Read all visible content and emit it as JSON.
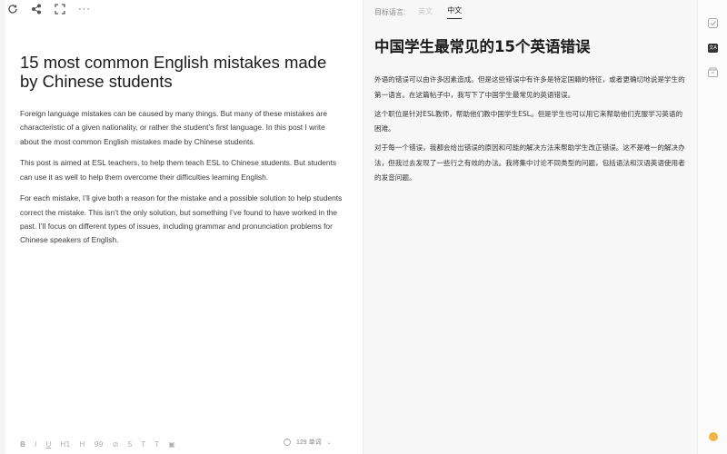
{
  "toolbar": {
    "icons": [
      "refresh-icon",
      "share-icon",
      "fullscreen-icon"
    ],
    "more_label": "···"
  },
  "document": {
    "title": "15 most common English mistakes made by Chinese students",
    "paragraphs": [
      "Foreign language mistakes can be caused by many things. But many of these mistakes are characteristic of a given nationality, or rather the student’s first language. In this post I write about the most common English mistakes made by Chinese students.",
      "This post is aimed at ESL teachers, to help them teach ESL to Chinese students. But students can use it as well to help them overcome their difficulties learning English.",
      "For each mistake, I’ll give both a reason for the mistake and a possible solution to help students correct the mistake. This isn’t the only solution, but something I’ve found to have worked in the past. I’ll focus on different types of issues, including grammar and pronunciation problems for Chinese speakers of English."
    ]
  },
  "format_bar": {
    "bold": "B",
    "italic": "I",
    "underline": "U",
    "heading1": "H1",
    "heading2": "H",
    "quote": "99",
    "link": "⊘",
    "strike": "S",
    "textcolor": "T",
    "highlight": "T",
    "image": "▣",
    "word_count": "129 单词",
    "word_count_chevron": "⌄"
  },
  "translation": {
    "target_lang_label": "目标语言:",
    "tabs": [
      {
        "label": "英文",
        "active": false
      },
      {
        "label": "中文",
        "active": true
      }
    ],
    "title": "中国学生最常见的15个英语错误",
    "paragraphs": [
      "外语的错误可以由许多因素造成。但是这些错误中有许多是特定国籍的特征，或者更确切地说是学生的第一语言。在这篇帖子中，我写下了中国学生最常见的英语错误。",
      "这个职位是针对ESL教师，帮助他们教中国学生ESL。但是学生也可以用它来帮助他们克服学习英语的困难。",
      "对于每一个错误，我都会给出错误的原因和可能的解决方法来帮助学生改正错误。这不是唯一的解决办法，但我过去发现了一些行之有效的办法。我将集中讨论不同类型的问题，包括语法和汉语英语使用者的发音问题。"
    ]
  },
  "rail": {
    "icons": [
      "check-icon",
      "translate-icon",
      "archive-icon",
      "avatar"
    ],
    "translate_glyph": "文A"
  },
  "colors": {
    "active_tab_underline": "#222222",
    "translate_badge": "#333333",
    "avatar": "#f0b545"
  }
}
